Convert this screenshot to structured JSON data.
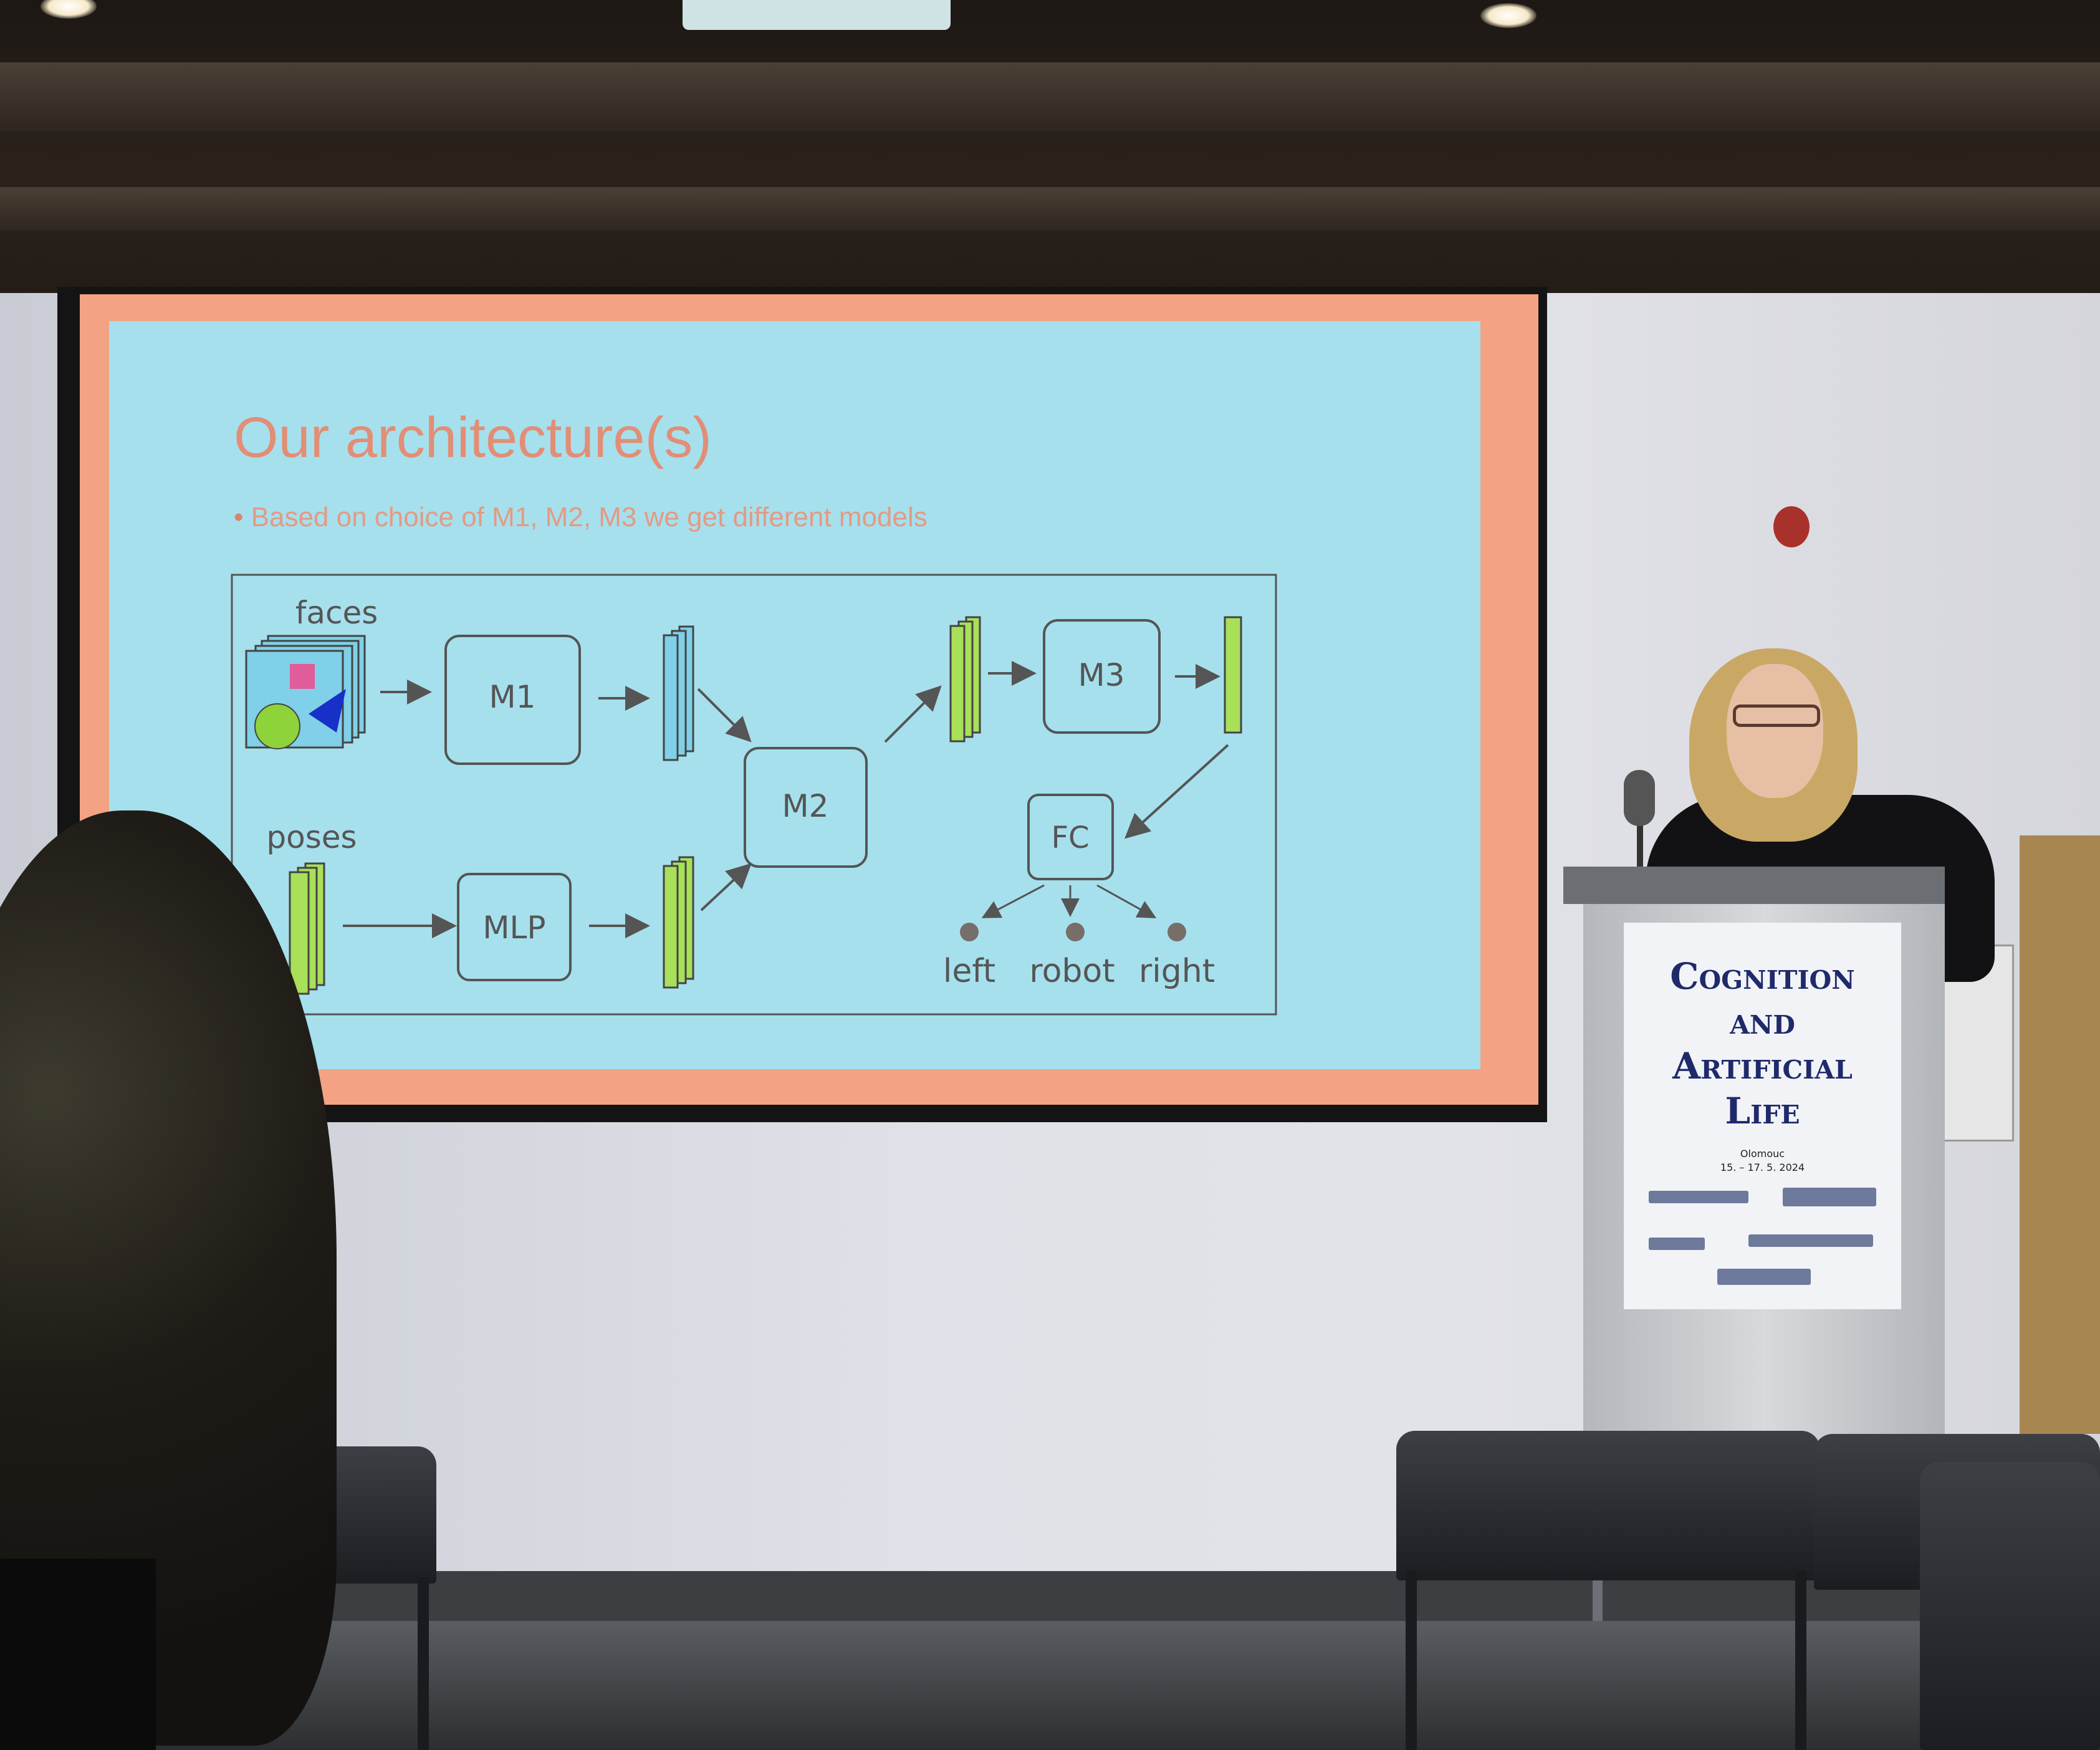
{
  "slide": {
    "title": "Our architecture(s)",
    "bullet": "Based on choice of M1, M2, M3 we get different models",
    "diagram": {
      "inputs": [
        "faces",
        "poses"
      ],
      "modules": [
        "M1",
        "MLP",
        "M2",
        "M3",
        "FC"
      ],
      "outputs": [
        "left",
        "robot",
        "right"
      ]
    }
  },
  "podium_poster": {
    "title": "Cognition\nand\nArtificial\nLife",
    "location_date": "Olomouc\n15. – 17. 5. 2024"
  },
  "colors": {
    "slide_background": "#a6e0ed",
    "slide_border": "#f3a283",
    "title_color": "#e28e76",
    "feature_green": "#a8e05a",
    "feature_cyan": "#7fd0e8",
    "poster_text": "#1f2a6b"
  }
}
